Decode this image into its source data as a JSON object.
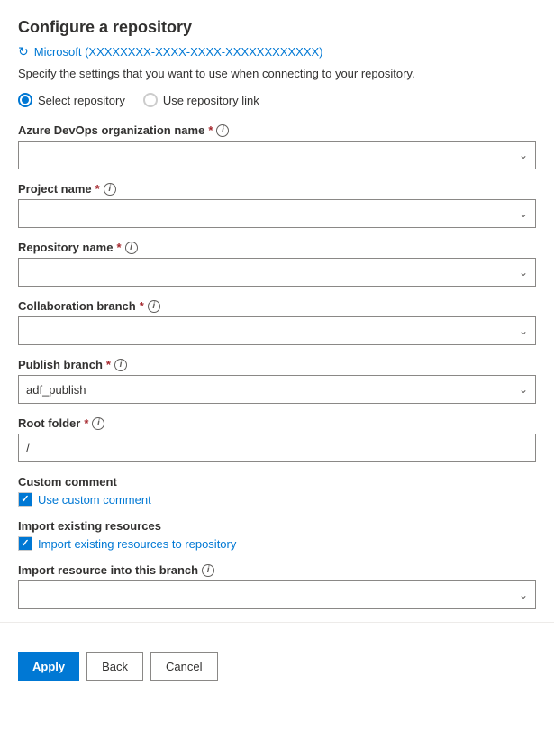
{
  "page": {
    "title": "Configure a repository",
    "account": "Microsoft (XXXXXXXX-XXXX-XXXX-XXXXXXXXXXXX)",
    "description": "Specify the settings that you want to use when connecting to your repository.",
    "radio_options": [
      {
        "id": "select-repo",
        "label": "Select repository",
        "selected": true
      },
      {
        "id": "use-link",
        "label": "Use repository link",
        "selected": false
      }
    ],
    "fields": [
      {
        "id": "azure-devops-org",
        "label": "Azure DevOps organization name",
        "required": true,
        "has_info": true,
        "type": "dropdown",
        "value": ""
      },
      {
        "id": "project-name",
        "label": "Project name",
        "required": true,
        "has_info": true,
        "type": "dropdown",
        "value": ""
      },
      {
        "id": "repository-name",
        "label": "Repository name",
        "required": true,
        "has_info": true,
        "type": "dropdown",
        "value": ""
      },
      {
        "id": "collaboration-branch",
        "label": "Collaboration branch",
        "required": true,
        "has_info": true,
        "type": "dropdown",
        "value": ""
      },
      {
        "id": "publish-branch",
        "label": "Publish branch",
        "required": true,
        "has_info": true,
        "type": "dropdown",
        "value": "adf_publish"
      },
      {
        "id": "root-folder",
        "label": "Root folder",
        "required": true,
        "has_info": true,
        "type": "text",
        "value": "/"
      }
    ],
    "checkboxes": [
      {
        "id": "custom-comment",
        "section_label": "Custom comment",
        "option_label": "Use custom comment",
        "checked": true
      },
      {
        "id": "import-existing",
        "section_label": "Import existing resources",
        "option_label": "Import existing resources to repository",
        "checked": true
      }
    ],
    "import_branch_field": {
      "id": "import-resource-branch",
      "label": "Import resource into this branch",
      "has_info": true,
      "type": "dropdown",
      "value": ""
    },
    "buttons": {
      "apply": "Apply",
      "back": "Back",
      "cancel": "Cancel"
    }
  }
}
